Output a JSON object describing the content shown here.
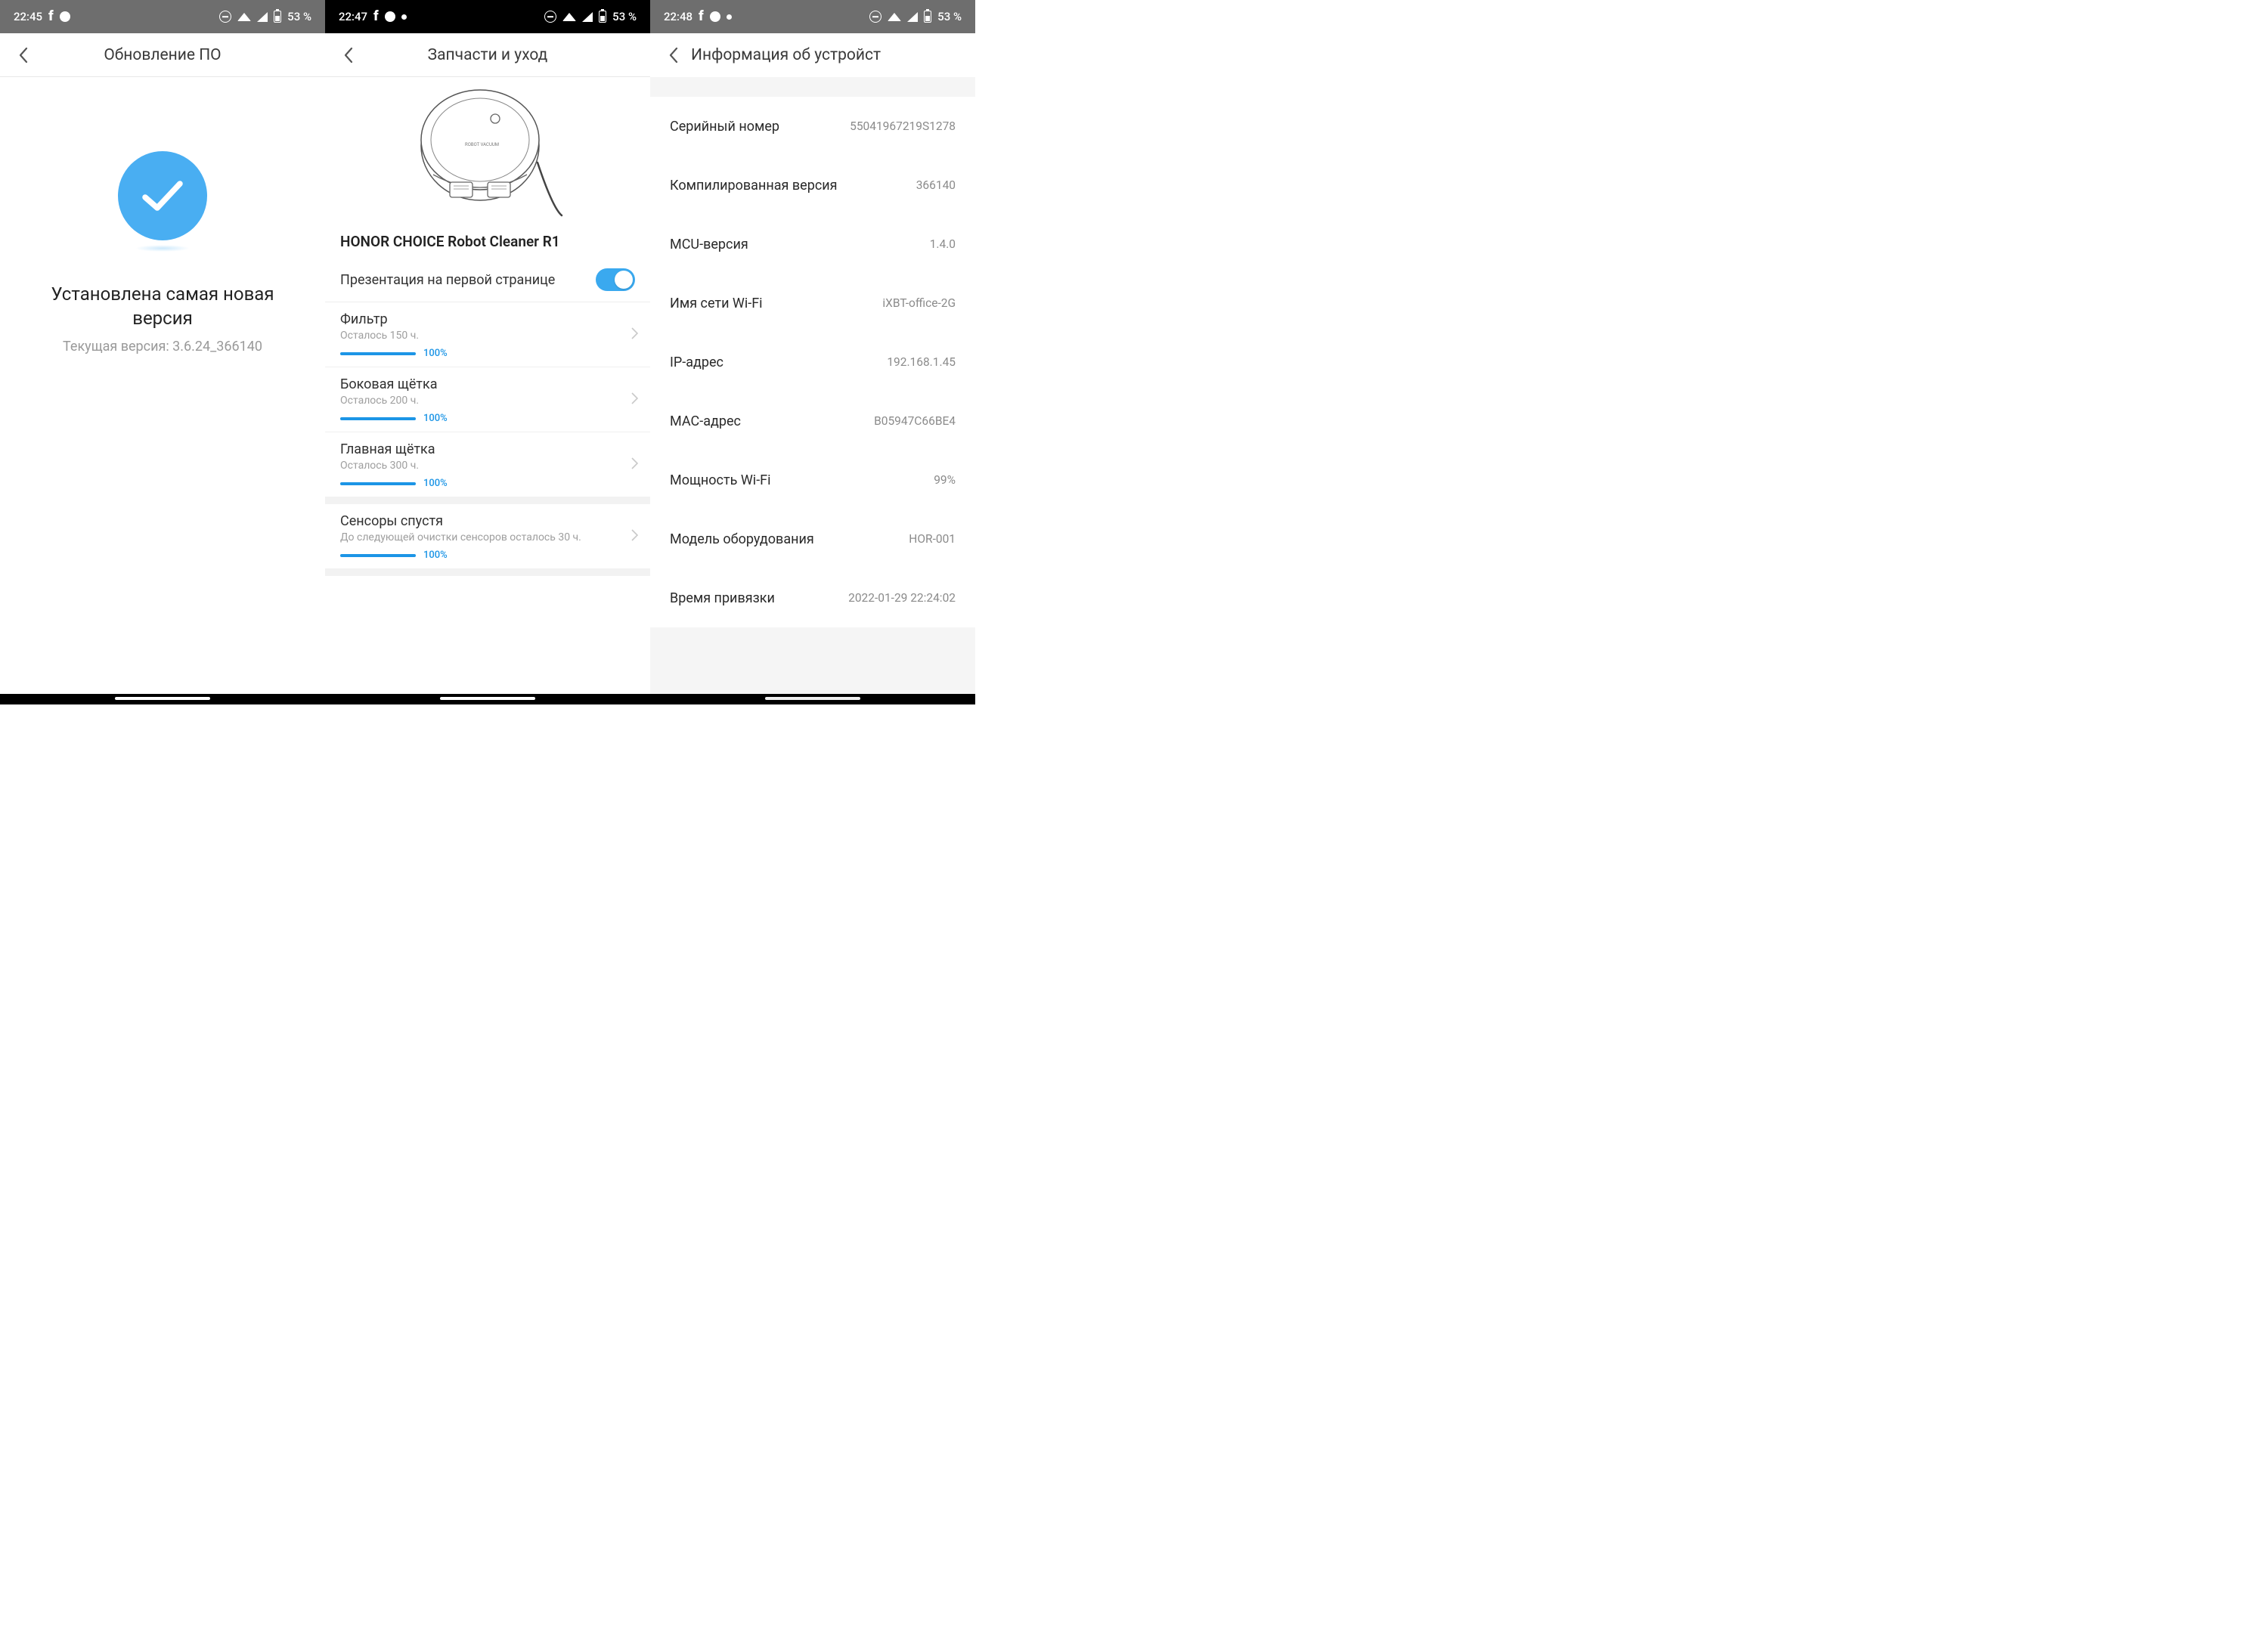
{
  "statusbar": {
    "s1": {
      "time": "22:45",
      "battery": "53 %"
    },
    "s2": {
      "time": "22:47",
      "battery": "53 %"
    },
    "s3": {
      "time": "22:48",
      "battery": "53 %"
    }
  },
  "screen1": {
    "title": "Обновление ПО",
    "headline": "Установлена самая новая версия",
    "version_line": "Текущая версия: 3.6.24_366140"
  },
  "screen2": {
    "title": "Запчасти и уход",
    "device": "HONOR CHOICE Robot Cleaner R1",
    "toggle_label": "Презентация на первой странице",
    "parts": [
      {
        "name": "Фильтр",
        "remaining": "Осталось 150 ч.",
        "percent": "100%"
      },
      {
        "name": "Боковая щётка",
        "remaining": "Осталось 200 ч.",
        "percent": "100%"
      },
      {
        "name": "Главная щётка",
        "remaining": "Осталось 300 ч.",
        "percent": "100%"
      },
      {
        "name": "Сенсоры спустя",
        "remaining": "До следующей очистки сенсоров осталось 30 ч.",
        "percent": "100%"
      }
    ]
  },
  "screen3": {
    "title": "Информация об устройст",
    "rows": [
      {
        "label": "Серийный номер",
        "value": "55041967219S1278"
      },
      {
        "label": "Компилированная версия",
        "value": "366140"
      },
      {
        "label": "MCU-версия",
        "value": "1.4.0"
      },
      {
        "label": "Имя сети Wi-Fi",
        "value": "iXBT-office-2G"
      },
      {
        "label": "IP-адрес",
        "value": "192.168.1.45"
      },
      {
        "label": "MAC-адрес",
        "value": "B05947C66BE4"
      },
      {
        "label": "Мощность Wi-Fi",
        "value": "99%"
      },
      {
        "label": "Модель оборудования",
        "value": "HOR-001"
      },
      {
        "label": "Время привязки",
        "value": "2022-01-29 22:24:02"
      }
    ]
  }
}
